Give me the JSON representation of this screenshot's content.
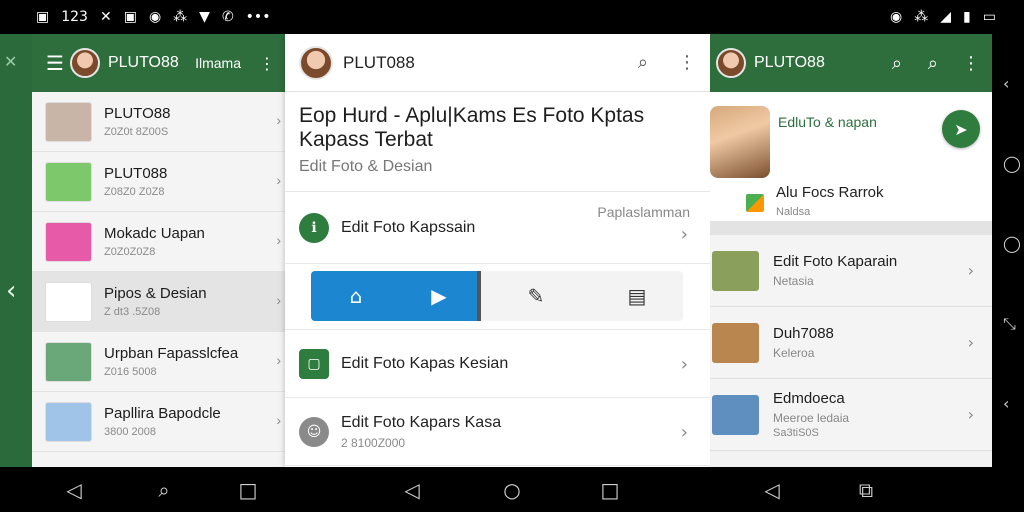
{
  "status_bar": {
    "left_icons": [
      "gallery-icon",
      "signal-123-icon",
      "shuffle-icon",
      "image-icon",
      "circle-icon",
      "vibrate-icon",
      "wifi-icon",
      "location-icon",
      "more-icon"
    ],
    "left_glyphs": [
      "▣",
      "123",
      "✕",
      "▣",
      "◉",
      "⁂",
      "▼",
      "✆",
      "•••"
    ],
    "right_glyphs": [
      "◉",
      "⁂",
      "◢",
      "▮",
      "▭"
    ]
  },
  "panel1": {
    "title": "PLUTO88",
    "name": "Ilmama",
    "items": [
      {
        "title": "PLUTO88",
        "subtitle": "Z0Z0t 8Z00S",
        "thumb": "#c9b5a8"
      },
      {
        "title": "PLUT088",
        "subtitle": "Z08Z0 Z0Z8",
        "thumb": "#7cc86a"
      },
      {
        "title": "Mokadc Uapan",
        "subtitle": "Z0Z0Z0Z8",
        "thumb": "#e75aa8"
      },
      {
        "title": "Pipos & Desian",
        "subtitle": "Z dt3 .5Z08",
        "thumb": "#ffffff"
      },
      {
        "title": "Urpban Fapasslcfea",
        "subtitle": "Z016 5008",
        "thumb": "#6aa879"
      },
      {
        "title": "Papllira Bapodcle",
        "subtitle": "3800 2008",
        "thumb": "#a0c4e8"
      }
    ]
  },
  "panel2": {
    "title": "PLUT088",
    "heading": "Eop Hurd - Aplu|Kams Es Foto Kptas Kapass Terbat",
    "subheading": "Edit Foto & Desian",
    "item1": {
      "label": "Edit Foto Kapssain",
      "note": "Paplaslamman"
    },
    "item2": {
      "label": "Edit Foto Kapas Kesian"
    },
    "item3": {
      "label": "Edit Foto Kapars Kasa",
      "sub": "2 8100Z000"
    },
    "accent": "#1c86d0"
  },
  "panel3": {
    "title": "PLUTO88",
    "card_title": "EdluTo & napan",
    "card_item": "Alu Focs Rarrok",
    "card_item_sub": "Naldsa",
    "rows": [
      {
        "t1": "Edit Foto Kaparain",
        "t2": "Netasia",
        "t3": ""
      },
      {
        "t1": "Duh7088",
        "t2": "Keleroa",
        "t3": ""
      },
      {
        "t1": "Edmdoeca",
        "t2": "Meeroe ledaia",
        "t3": "Sa3tiS0S"
      }
    ]
  }
}
